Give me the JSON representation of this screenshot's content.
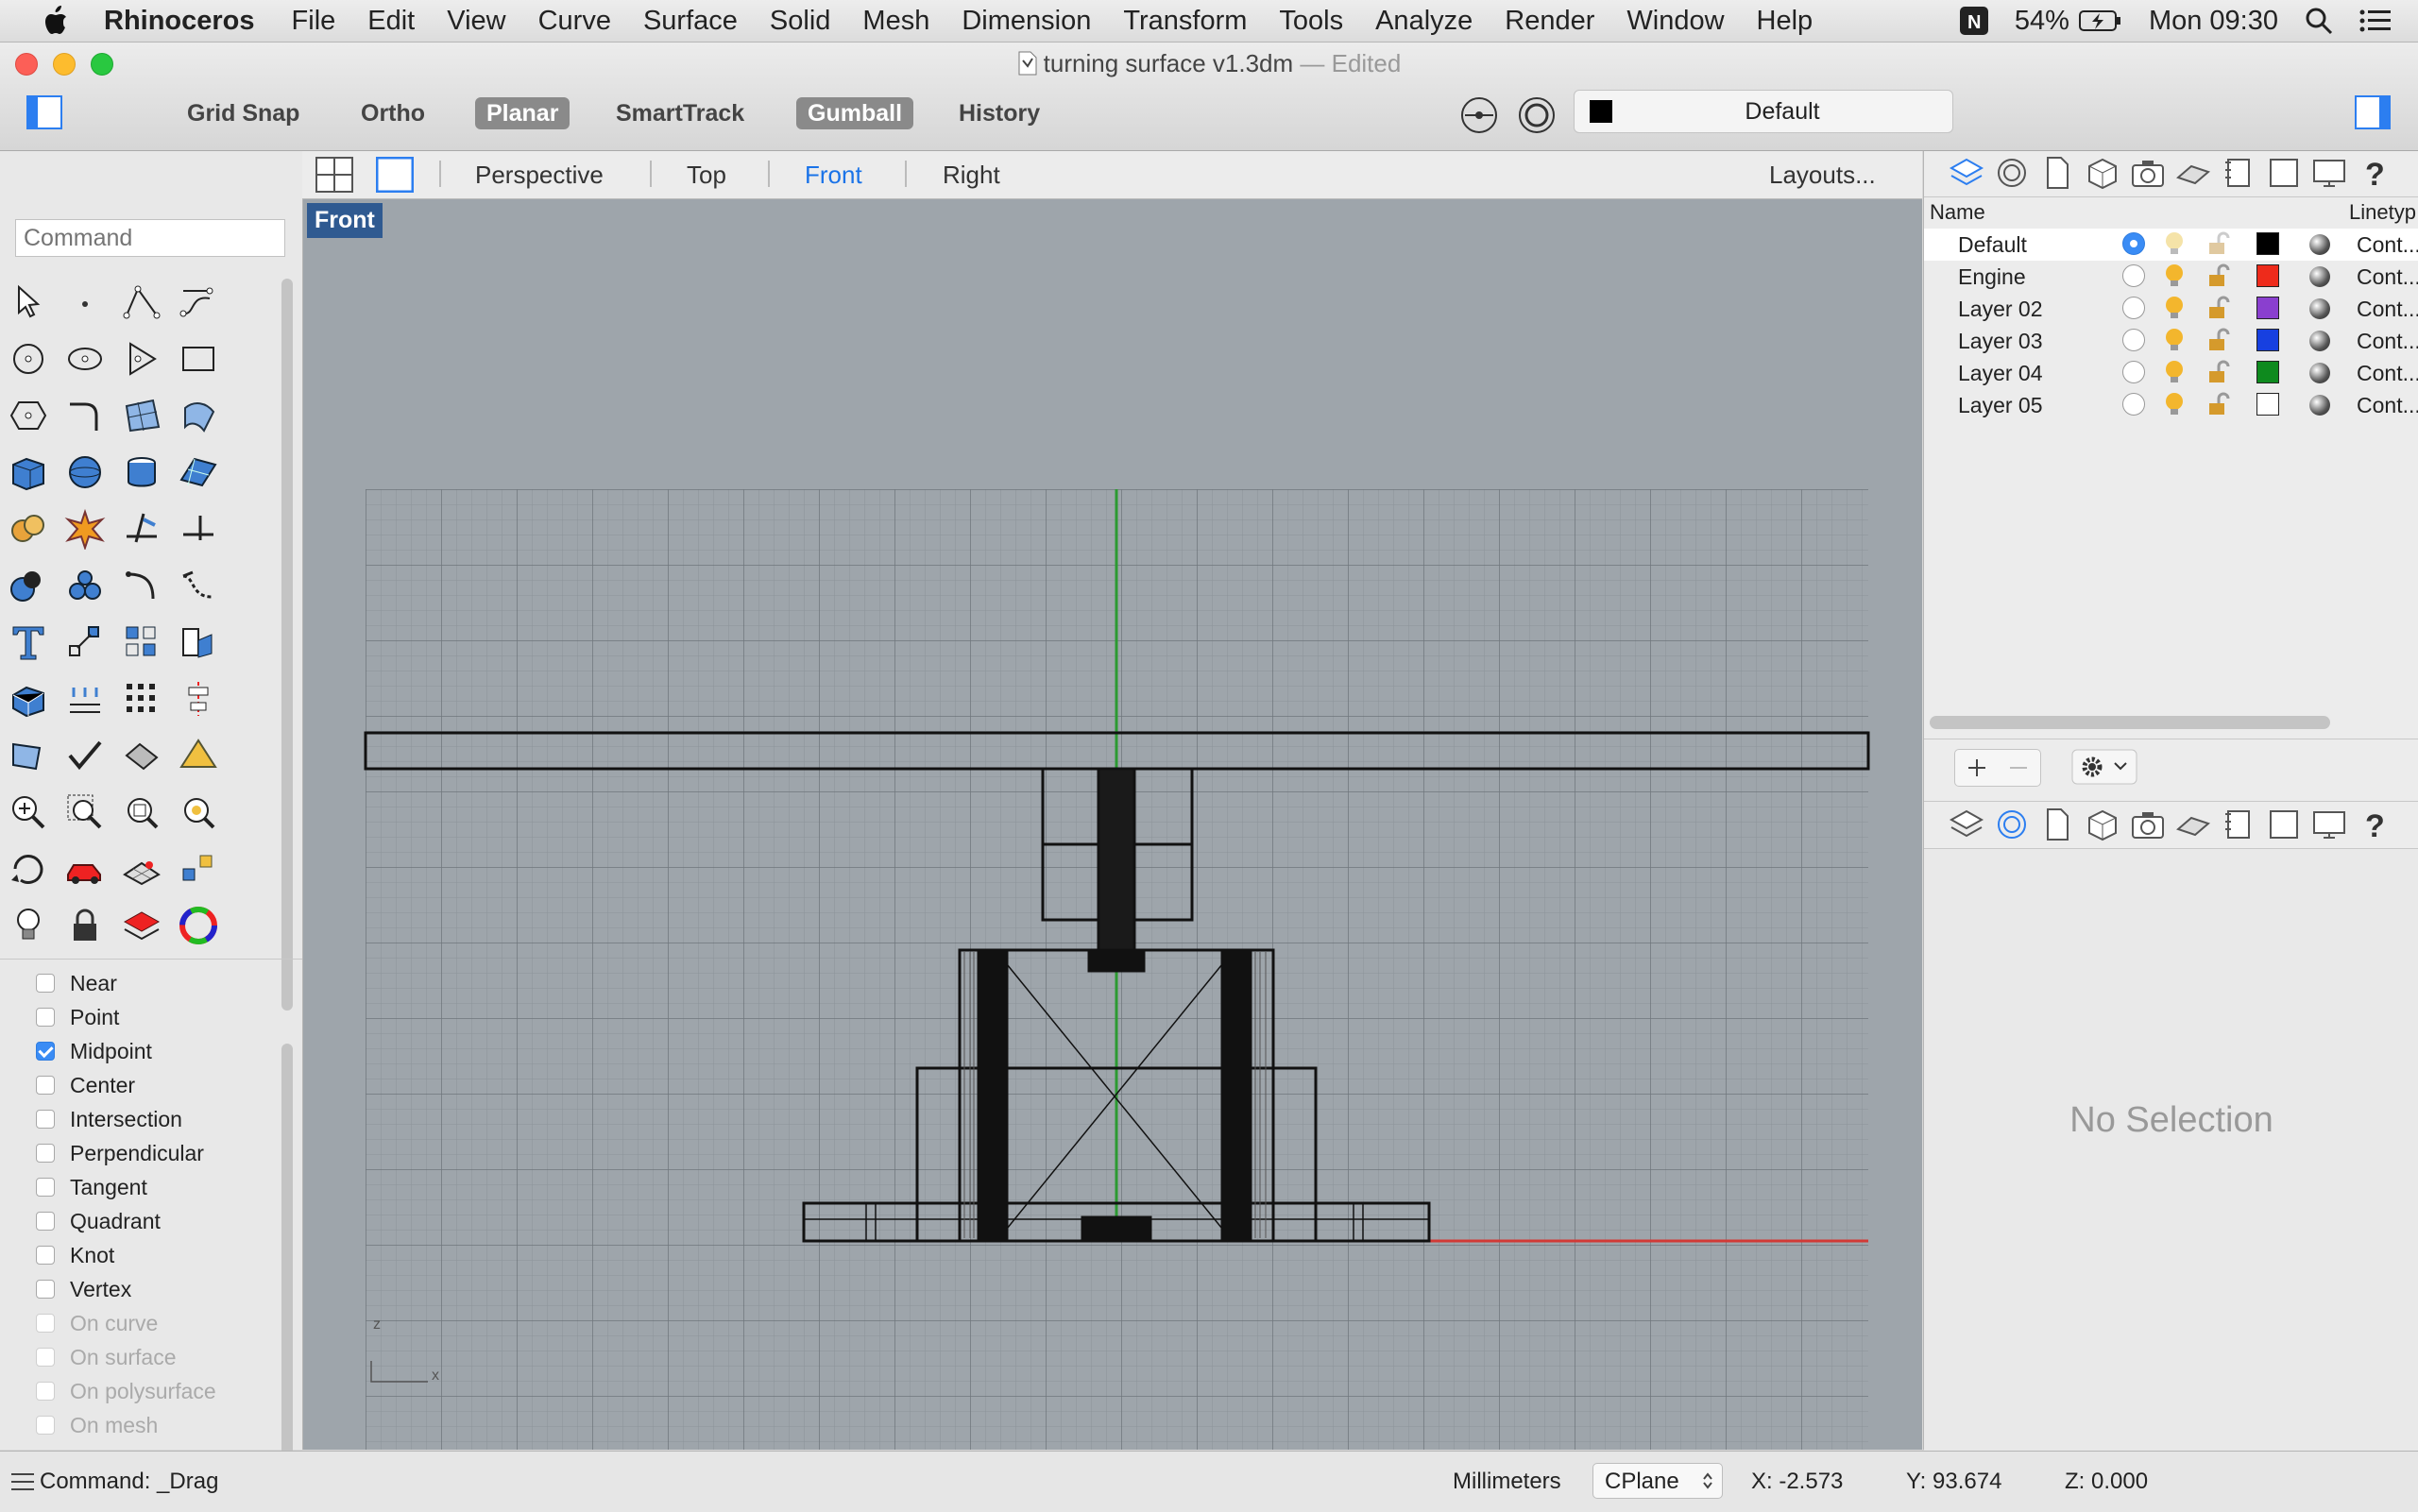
{
  "menubar": {
    "app_name": "Rhinoceros",
    "items": [
      "File",
      "Edit",
      "View",
      "Curve",
      "Surface",
      "Solid",
      "Mesh",
      "Dimension",
      "Transform",
      "Tools",
      "Analyze",
      "Render",
      "Window",
      "Help"
    ],
    "battery": "54%",
    "clock": "Mon 09:30"
  },
  "window": {
    "title": "turning surface v1.3dm",
    "edited": "— Edited"
  },
  "toolbar": {
    "buttons": [
      {
        "label": "Grid Snap",
        "on": false
      },
      {
        "label": "Ortho",
        "on": false
      },
      {
        "label": "Planar",
        "on": true
      },
      {
        "label": "SmartTrack",
        "on": false
      },
      {
        "label": "Gumball",
        "on": true
      },
      {
        "label": "History",
        "on": false
      }
    ],
    "current_layer": "Default",
    "current_layer_color": "#000000"
  },
  "viewbar": {
    "tabs": [
      "Perspective",
      "Top",
      "Front",
      "Right"
    ],
    "active_tab": "Front",
    "layouts": "Layouts..."
  },
  "left": {
    "command_placeholder": "Command",
    "snaps": [
      {
        "label": "Near",
        "checked": false,
        "enabled": true
      },
      {
        "label": "Point",
        "checked": false,
        "enabled": true
      },
      {
        "label": "Midpoint",
        "checked": true,
        "enabled": true
      },
      {
        "label": "Center",
        "checked": false,
        "enabled": true
      },
      {
        "label": "Intersection",
        "checked": false,
        "enabled": true
      },
      {
        "label": "Perpendicular",
        "checked": false,
        "enabled": true
      },
      {
        "label": "Tangent",
        "checked": false,
        "enabled": true
      },
      {
        "label": "Quadrant",
        "checked": false,
        "enabled": true
      },
      {
        "label": "Knot",
        "checked": false,
        "enabled": true
      },
      {
        "label": "Vertex",
        "checked": false,
        "enabled": true
      },
      {
        "label": "On curve",
        "checked": false,
        "enabled": false
      },
      {
        "label": "On surface",
        "checked": false,
        "enabled": false
      },
      {
        "label": "On polysurface",
        "checked": false,
        "enabled": false
      },
      {
        "label": "On mesh",
        "checked": false,
        "enabled": false
      }
    ]
  },
  "viewport": {
    "label": "Front",
    "axis_z": "z",
    "axis_x": "x"
  },
  "layers": {
    "col_name": "Name",
    "col_linetype": "Linetyp",
    "rows": [
      {
        "name": "Default",
        "current": true,
        "color": "#000000",
        "linetype": "Cont..."
      },
      {
        "name": "Engine",
        "current": false,
        "color": "#ee2b1b",
        "linetype": "Cont..."
      },
      {
        "name": "Layer 02",
        "current": false,
        "color": "#8a3fcf",
        "linetype": "Cont..."
      },
      {
        "name": "Layer 03",
        "current": false,
        "color": "#1740e0",
        "linetype": "Cont..."
      },
      {
        "name": "Layer 04",
        "current": false,
        "color": "#0e8a1e",
        "linetype": "Cont..."
      },
      {
        "name": "Layer 05",
        "current": false,
        "color": "#ffffff",
        "linetype": "Cont..."
      }
    ]
  },
  "properties": {
    "empty_text": "No Selection"
  },
  "status": {
    "command": "Command: _Drag",
    "units": "Millimeters",
    "cplane": "CPlane",
    "x": "X: -2.573",
    "y": "Y: 93.674",
    "z": "Z: 0.000"
  }
}
